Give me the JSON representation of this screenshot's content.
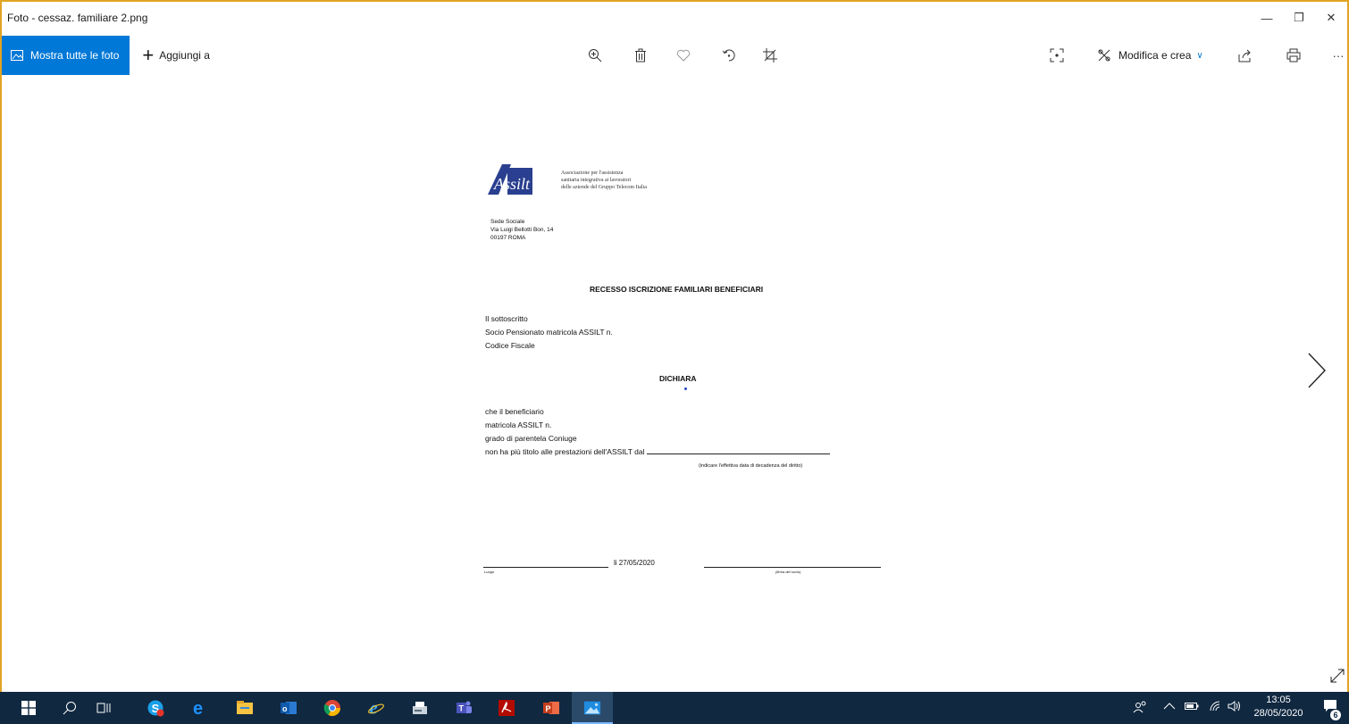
{
  "window": {
    "title": "Foto - cessaz. familiare 2.png"
  },
  "window_controls": {
    "minimize": "—",
    "restore": "❐",
    "close": "✕"
  },
  "toolbar": {
    "show_all_label": "Mostra tutte le foto",
    "add_to_label": "Aggiungi a",
    "edit_create_label": "Modifica e crea",
    "more_label": "···"
  },
  "document": {
    "logo_text": "Associazione per l'assistenza sanitaria integrativa ai lavoratori delle aziende del Gruppo Telecom Italia",
    "logo_lines": [
      "Associazione per l'assistenza",
      "sanitaria integrativa ai lavoratori",
      "delle aziende del Gruppo Telecom Italia"
    ],
    "logo_mark": "Assilt",
    "sede": [
      "Sede Sociale",
      "Via Luigi Bellotti Bon, 14",
      "00197 ROMA"
    ],
    "heading": "RECESSO ISCRIZIONE FAMILIARI BENEFICIARI",
    "lines1": [
      "Il sottoscritto",
      "Socio Pensionato  matricola ASSILT n.",
      "Codice Fiscale"
    ],
    "dichiara": "DICHIARA",
    "lines2": [
      "che il beneficiario",
      "matricola ASSILT n.",
      "grado di parentela Coniuge"
    ],
    "last_line": "non ha più titolo alle prestazioni dell'ASSILT dal",
    "note": "(indicare l'effettiva data di decadenza del diritto)",
    "sig_date": "li 27/05/2020",
    "label_left": "Luogo",
    "label_right": "(firma del socio)"
  },
  "taskbar": {
    "clock_time": "13:05",
    "clock_date": "28/05/2020",
    "notification_count": "6"
  },
  "colors": {
    "accent": "#0078d7",
    "window_border": "#e0a424",
    "taskbar": "#102840"
  }
}
